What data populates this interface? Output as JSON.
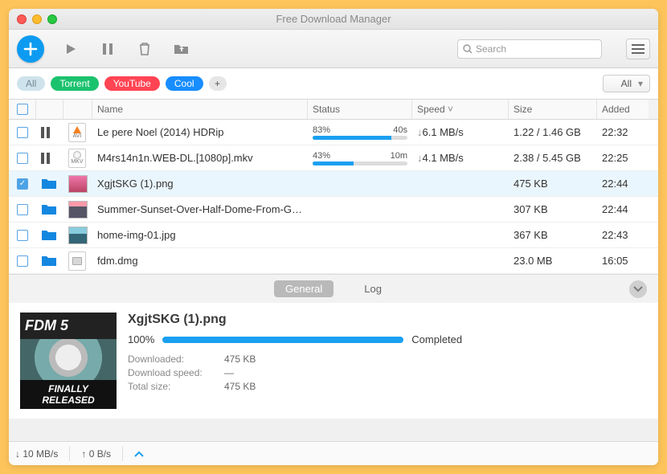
{
  "window": {
    "title": "Free Download Manager"
  },
  "toolbar": {
    "search_placeholder": "Search"
  },
  "tags": {
    "all": "All",
    "items": [
      "Torrent",
      "YouTube",
      "Cool"
    ]
  },
  "filter": {
    "selected": "All"
  },
  "columns": {
    "name": "Name",
    "status": "Status",
    "speed": "Speed",
    "size": "Size",
    "added": "Added"
  },
  "rows": [
    {
      "name": "Le pere Noel (2014) HDRip",
      "percent": "83%",
      "eta": "40s",
      "progress": 83,
      "speed": "6.1 MB/s",
      "size": "1.22 / 1.46 GB",
      "added": "22:32",
      "checked": false,
      "paused": true,
      "icon": "avi"
    },
    {
      "name": "M4rs14n1n.WEB-DL.[1080p].mkv",
      "percent": "43%",
      "eta": "10m",
      "progress": 43,
      "speed": "4.1 MB/s",
      "size": "2.38 / 5.45 GB",
      "added": "22:25",
      "checked": false,
      "paused": true,
      "icon": "mkv"
    },
    {
      "name": "XgjtSKG (1).png",
      "size": "475 KB",
      "added": "22:44",
      "checked": true,
      "selected": true,
      "folder": true,
      "icon": "thumb-pink"
    },
    {
      "name": "Summer-Sunset-Over-Half-Dome-From-Glacier-Point-Yosemite-National-Park...",
      "size": "307 KB",
      "added": "22:44",
      "checked": false,
      "folder": true,
      "icon": "thumb-sunset"
    },
    {
      "name": "home-img-01.jpg",
      "size": "367 KB",
      "added": "22:43",
      "checked": false,
      "folder": true,
      "icon": "thumb-blue"
    },
    {
      "name": "fdm.dmg",
      "size": "23.0 MB",
      "added": "16:05",
      "checked": false,
      "folder": true,
      "icon": "dmg"
    }
  ],
  "tabs": {
    "general": "General",
    "log": "Log"
  },
  "detail": {
    "name": "XgjtSKG (1).png",
    "percent": "100%",
    "status": "Completed",
    "downloaded_label": "Downloaded:",
    "downloaded": "475 KB",
    "speed_label": "Download speed:",
    "speed": "—",
    "total_label": "Total size:",
    "total": "475 KB",
    "preview_top": "FDM 5",
    "preview_bottom": "FINALLY RELEASED"
  },
  "statusbar": {
    "down": "10 MB/s",
    "up": "0 B/s"
  }
}
